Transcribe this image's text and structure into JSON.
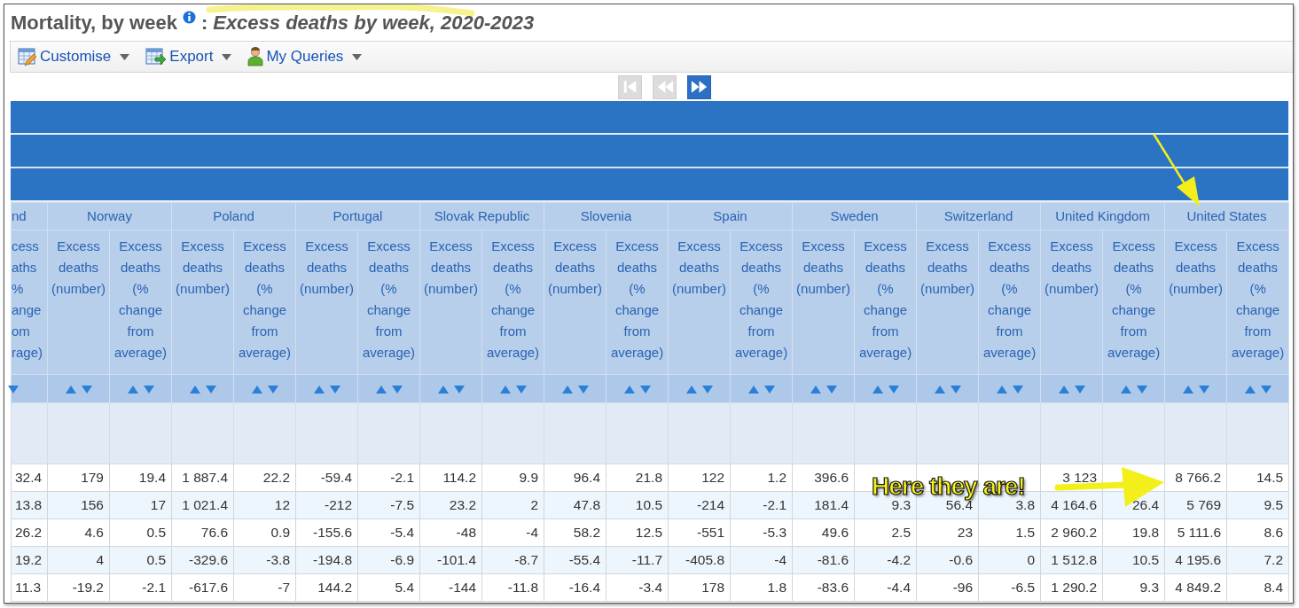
{
  "title": {
    "main": "Mortality, by week",
    "separator": ":",
    "subtitle": "Excess deaths by week, 2020-2023",
    "highlighted": true
  },
  "toolbar": [
    {
      "kind": "customise",
      "label": "Customise"
    },
    {
      "kind": "export",
      "label": "Export"
    },
    {
      "kind": "queries",
      "label": "My Queries"
    }
  ],
  "pager": [
    {
      "kind": "first",
      "disabled": true
    },
    {
      "kind": "previous",
      "disabled": true
    },
    {
      "kind": "last",
      "disabled": false
    }
  ],
  "table": {
    "partial_column": {
      "country": "nd",
      "header": "cess\naths\n%\nange\nom\nrage)"
    },
    "countries": [
      {
        "name": "Norway",
        "columns": [
          "Excess deaths (number)",
          "Excess deaths (% change from average)"
        ]
      },
      {
        "name": "Poland",
        "columns": [
          "Excess deaths (number)",
          "Excess deaths (% change from average)"
        ]
      },
      {
        "name": "Portugal",
        "columns": [
          "Excess deaths (number)",
          "Excess deaths (% change from average)"
        ]
      },
      {
        "name": "Slovak Republic",
        "columns": [
          "Excess deaths (number)",
          "Excess deaths (% change from average)"
        ]
      },
      {
        "name": "Slovenia",
        "columns": [
          "Excess deaths (number)",
          "Excess deaths (% change from average)"
        ]
      },
      {
        "name": "Spain",
        "columns": [
          "Excess deaths (number)",
          "Excess deaths (% change from average)"
        ]
      },
      {
        "name": "Sweden",
        "columns": [
          "Excess deaths (number)",
          "Excess deaths (% change from average)"
        ]
      },
      {
        "name": "Switzerland",
        "columns": [
          "Excess deaths (number)",
          "Excess deaths (% change from average)"
        ]
      },
      {
        "name": "United Kingdom",
        "columns": [
          "Excess deaths (number)",
          "Excess deaths (% change from average)"
        ]
      },
      {
        "name": "United States",
        "columns": [
          "Excess deaths (number)",
          "Excess deaths (% change from average)"
        ]
      }
    ],
    "rows": [
      [
        "32.4",
        "179",
        "19.4",
        "1 887.4",
        "22.2",
        "-59.4",
        "-2.1",
        "114.2",
        "9.9",
        "96.4",
        "21.8",
        "122",
        "1.2",
        "396.6",
        null,
        null,
        null,
        "3 123",
        null,
        "8 766.2",
        "14.5"
      ],
      [
        "13.8",
        "156",
        "17",
        "1 021.4",
        "12",
        "-212",
        "-7.5",
        "23.2",
        "2",
        "47.8",
        "10.5",
        "-214",
        "-2.1",
        "181.4",
        "9.3",
        "56.4",
        "3.8",
        "4 164.6",
        "26.4",
        "5 769",
        "9.5"
      ],
      [
        "26.2",
        "4.6",
        "0.5",
        "76.6",
        "0.9",
        "-155.6",
        "-5.4",
        "-48",
        "-4",
        "58.2",
        "12.5",
        "-551",
        "-5.3",
        "49.6",
        "2.5",
        "23",
        "1.5",
        "2 960.2",
        "19.8",
        "5 111.6",
        "8.6"
      ],
      [
        "19.2",
        "4",
        "0.5",
        "-329.6",
        "-3.8",
        "-194.8",
        "-6.9",
        "-101.4",
        "-8.7",
        "-55.4",
        "-11.7",
        "-405.8",
        "-4",
        "-81.6",
        "-4.2",
        "-0.6",
        "0",
        "1 512.8",
        "10.5",
        "4 195.6",
        "7.2"
      ],
      [
        "11.3",
        "-19.2",
        "-2.1",
        "-617.6",
        "-7",
        "144.2",
        "5.4",
        "-144",
        "-11.8",
        "-16.4",
        "-3.4",
        "178",
        "1.8",
        "-83.6",
        "-4.4",
        "-96",
        "-6.5",
        "1 290.2",
        "9.3",
        "4 849.2",
        "8.4"
      ]
    ]
  },
  "annotations": [
    {
      "kind": "arrow-down"
    },
    {
      "kind": "callout",
      "text": "Here they are!"
    }
  ]
}
